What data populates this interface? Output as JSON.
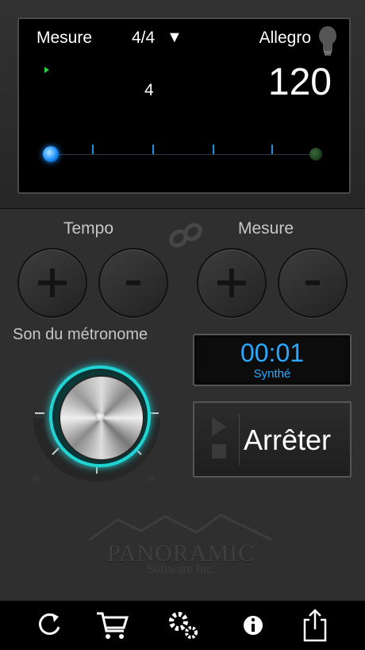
{
  "display": {
    "meter_label": "Mesure",
    "time_signature": "4/4",
    "ts_arrow": "▼",
    "tempo_name": "Allegro",
    "beat_count": "4",
    "bpm": "120"
  },
  "controls": {
    "tempo_label": "Tempo",
    "meter_label": "Mesure",
    "plus": "+",
    "minus": "-"
  },
  "sound": {
    "label": "Son du métronome",
    "time": "00:01",
    "name": "Synthé"
  },
  "stop_button": {
    "label": "Arrêter"
  },
  "brand": {
    "name": "PANORAMIC",
    "sub": "Software Inc."
  },
  "toolbar": {
    "icons": [
      "refresh-icon",
      "cart-icon",
      "settings-icon",
      "info-icon",
      "share-icon"
    ]
  },
  "colors": {
    "accent_blue": "#2aa8ff",
    "knob_cyan": "#22d3d3",
    "play_green": "#2ecc40"
  }
}
